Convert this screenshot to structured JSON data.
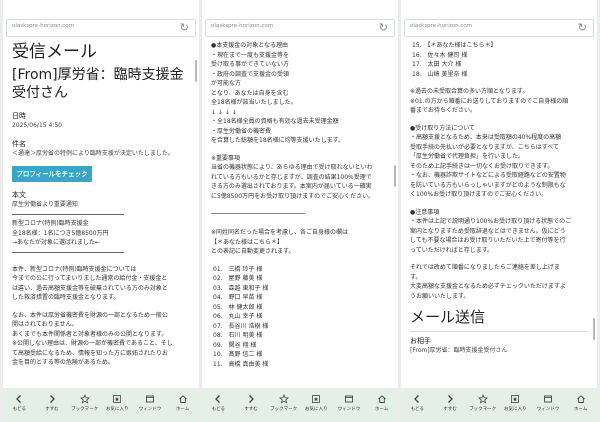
{
  "url": "olaskspre-horizon.com",
  "nav": [
    {
      "label": "もどる",
      "icon": "back-arrow-icon"
    },
    {
      "label": "すすむ",
      "icon": "forward-arrow-icon"
    },
    {
      "label": "ブックマーク",
      "icon": "bookmark-star-icon"
    },
    {
      "label": "お気に入り",
      "icon": "favorite-star-icon"
    },
    {
      "label": "ウィンドウ",
      "icon": "window-icon"
    },
    {
      "label": "ホーム",
      "icon": "home-icon"
    }
  ],
  "screen1": {
    "title": "受信メール",
    "from": "[From]厚労省：臨時支援金受付さん",
    "date_label": "日時",
    "date_value": "2025/06/15 4:50",
    "subject_label": "件名",
    "subject_value": "＜通達＞厚労省の特例により臨時支援が決定いたしました。",
    "profile_button": "プロフィールをチェック",
    "body_label": "本文",
    "body_intro": "厚生労働省より重要通知",
    "block": [
      "新型コロナ(特例)臨時支援金",
      "全18名様：1名につき5億8500万円",
      "→あなたが対象に選ばれました←"
    ],
    "para1": [
      "本件、新型コロナ(特例)臨時支援金については",
      "今までの公に行ってまいりました通常の給付金・支援金と",
      "は違い、過去高額支援金等を破棄されている方のみ対象と",
      "した救済措置の臨時支援金となります。"
    ],
    "para2": [
      "なお、本件は厚労省機密費を財源の一部となるため一般公",
      "開はされておりません。",
      "あくまでも本件関係者と対象者様のみの公開となります。",
      "※公開しない理由は、財源の一部が機密費であること、そし",
      "て高額受給になるため、情報を知った方に嫉妬されたりお",
      "金を目的とする等の危険があるため。"
    ]
  },
  "screen2": {
    "lines_a": [
      "●本支援金の対象となる理由",
      "・現在まで一度も支援金等を",
      "受け取る事ができていない方",
      "・政府の調査で支援金の受領",
      "が可能な方",
      "となり、あなたは自身を含む",
      "全18名様が該当いたしました。",
      "↓ ↓ ↓ ↓",
      "・全18名様全員の資格も有効な過去未受理金額",
      "・厚生労働省の機密費",
      "を合算した総額を18名様に均等支援いたします。"
    ],
    "lines_b": [
      "※重要事項",
      "当省の機器状態により、あらゆる理由で受け取れないといわ",
      "れている方もいるかと存じますが、調査の結果100%受理で",
      "きる方のみ選出されております。本案内が届いている一確実",
      "に5億8500万円をお受け取り頂けますのでご安心ください。"
    ],
    "lines_c": [
      "※同姓同名だった場合を考慮し、各ご自身様の欄は",
      "【＊あなた様はこちら＊】",
      "との表記に自動変更されます。"
    ],
    "recipients": [
      "01.　三橋 玲子 様",
      "02.　屋野 藤美 様",
      "03.　森越 東和子 様",
      "04.　野口 早苗 様",
      "05.　林 健太郎 様",
      "06.　丸山 幸子 様",
      "07.　長谷川 浩樹 様",
      "08.　石川 明美 様",
      "09.　関谷 翔 様",
      "10.　髙野 信二 様",
      "11.　高橋 真由美 様"
    ]
  },
  "screen3": {
    "recipients": [
      "15.　【＊あなた様はこちら＊】",
      "16.　佐々木 健司 様",
      "17.　太田 大介 様",
      "18.　山崎 美里奈 様"
    ],
    "lines_a": [
      "※過去の未受取合算の多い方順となります。",
      "※01.の方から順番にお送りしておりますのでご自身様の順",
      "番までお待ちください。"
    ],
    "lines_b": [
      "●受け取り方法について",
      "・高額支援となるため、本来は受取額の40%程度の高額",
      "受取手続の先払いが必要となりますが、こちらはすべて",
      "「厚生労働省で代理負担」を行いました。",
      "そのため上記手続きは一切なくお受け取りできます。",
      "・なお、機器詐欺サイトなどによる受取経路などの安置物",
      "を防いている方もいらっしゃいますがどのような制限もな",
      "く100%お受け取り頂けますのでご安心ください。"
    ],
    "lines_c": [
      "●注意事項",
      "・本件は上記で説明通り100%お受け取り頂ける状態でのご",
      "案内となりますため受取辞退などはできません。仮にどう",
      "しても不要な場合はお受け取りいただいた上で寄付等を行",
      "っていただければと存じます。"
    ],
    "lines_d": [
      "それでは改めて順番になりましたらご連絡を差し上げま",
      "す。",
      "大変高額な支援金となるため必ずチェックいただけますよ",
      "うお願いいたします。"
    ],
    "send_title": "メール送信",
    "to_label": "お相手",
    "to_value": "[From]厚労省：臨時支援金受付さん"
  }
}
